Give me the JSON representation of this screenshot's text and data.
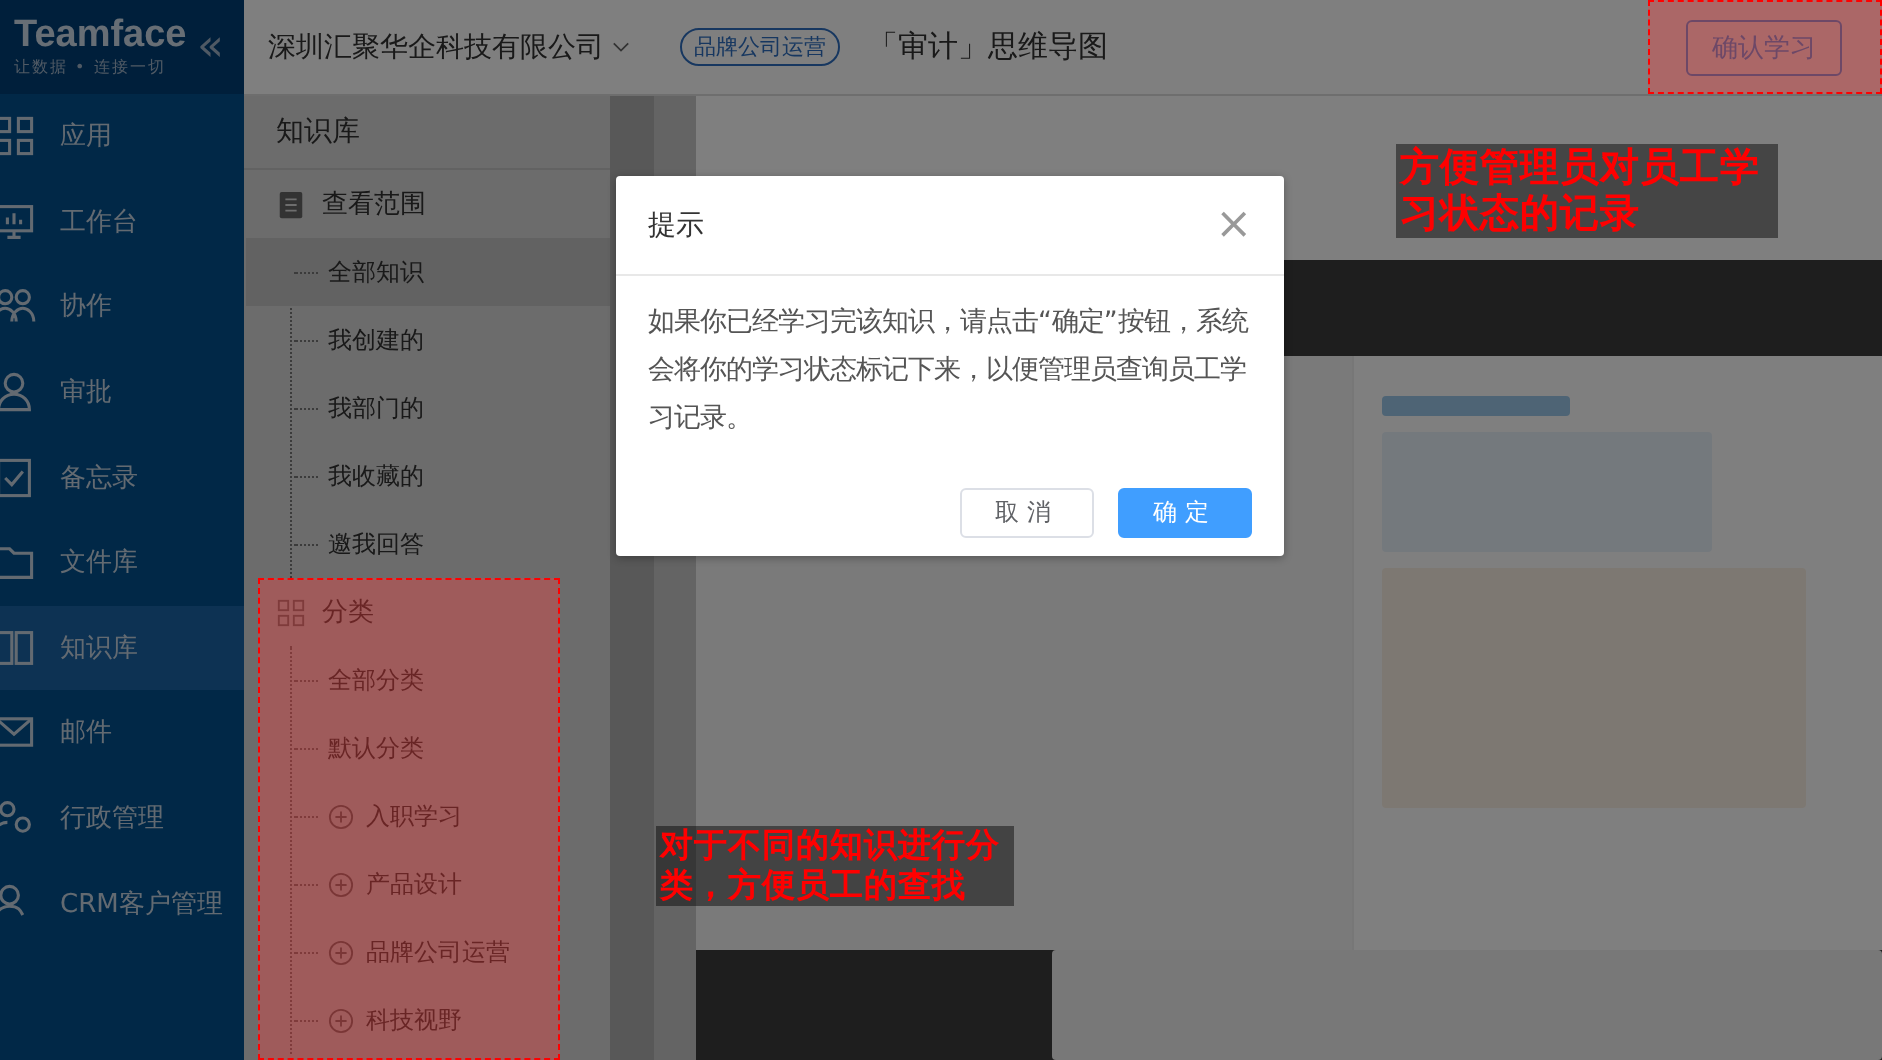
{
  "sidebar": {
    "logo": "Teamface",
    "slogan": "让数据 • 连接一切",
    "collapse": "«",
    "items": [
      {
        "label": "应用",
        "selected": false
      },
      {
        "label": "工作台",
        "selected": false
      },
      {
        "label": "协作",
        "selected": false
      },
      {
        "label": "审批",
        "selected": false
      },
      {
        "label": "备忘录",
        "selected": false
      },
      {
        "label": "文件库",
        "selected": false
      },
      {
        "label": "知识库",
        "selected": true
      },
      {
        "label": "邮件",
        "selected": false
      },
      {
        "label": "行政管理",
        "selected": false
      },
      {
        "label": "CRM客户管理",
        "selected": false
      }
    ]
  },
  "company": {
    "name": "深圳汇聚华企科技有限公司"
  },
  "knowledge_panel": {
    "title": "知识库",
    "sections": [
      {
        "label": "查看范围",
        "children": [
          {
            "label": "全部知识",
            "selected": true,
            "expandable": false
          },
          {
            "label": "我创建的",
            "selected": false,
            "expandable": false
          },
          {
            "label": "我部门的",
            "selected": false,
            "expandable": false
          },
          {
            "label": "我收藏的",
            "selected": false,
            "expandable": false
          },
          {
            "label": "邀我回答",
            "selected": false,
            "expandable": false
          }
        ]
      },
      {
        "label": "分类",
        "children": [
          {
            "label": "全部分类",
            "selected": false,
            "expandable": false
          },
          {
            "label": "默认分类",
            "selected": false,
            "expandable": false
          },
          {
            "label": "入职学习",
            "selected": false,
            "expandable": true
          },
          {
            "label": "产品设计",
            "selected": false,
            "expandable": true
          },
          {
            "label": "品牌公司运营",
            "selected": false,
            "expandable": true
          },
          {
            "label": "科技视野",
            "selected": false,
            "expandable": true
          }
        ]
      }
    ]
  },
  "document": {
    "tag": "品牌公司运营",
    "title": "「审计」思维导图",
    "confirm_button": "确认学习"
  },
  "dialog": {
    "title": "提示",
    "close": "×",
    "message": "如果你已经学习完该知识，请点击“确定”按钮，系统会将你的学习状态标记下来，以便管理员查询员工学习记录。",
    "buttons": [
      {
        "label": "取消",
        "kind": "default"
      },
      {
        "label": "确定",
        "kind": "primary"
      }
    ]
  },
  "annotations": [
    {
      "text": "方便管理员对员工学习状态的记录",
      "kind": "top"
    },
    {
      "text": "对于不同的知识进行分类，方便员工的查找",
      "kind": "side"
    }
  ]
}
